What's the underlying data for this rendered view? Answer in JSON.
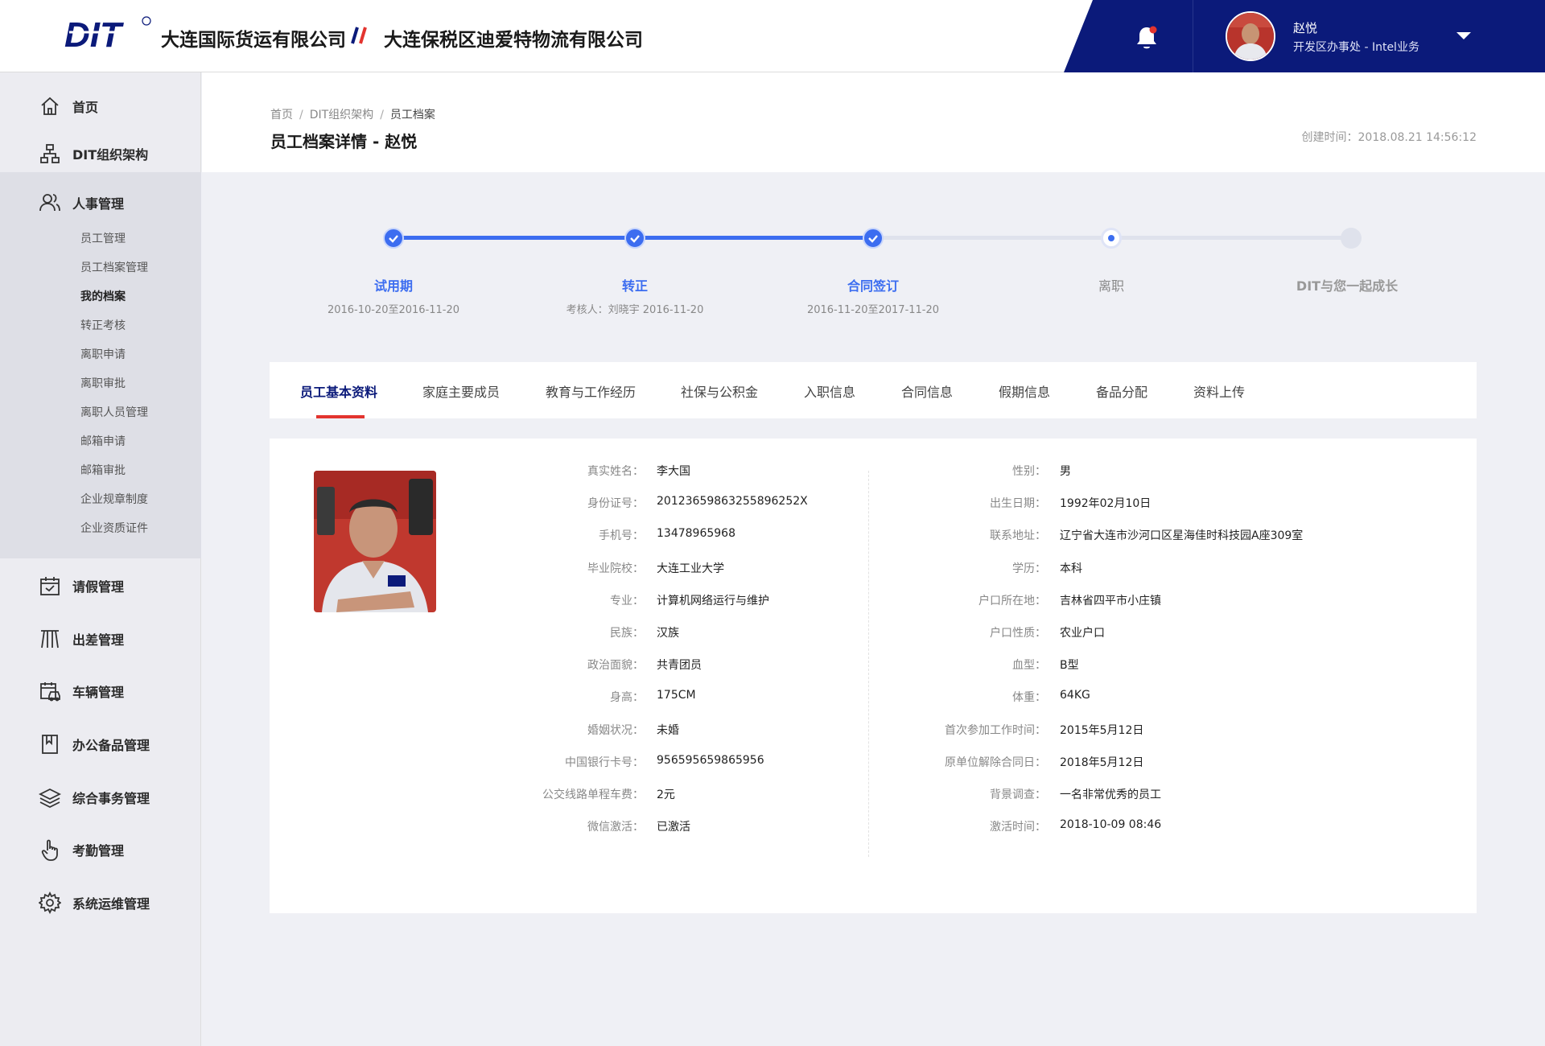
{
  "header": {
    "logo_text": "DIT",
    "company_1": "大连国际货运有限公司",
    "company_2": "大连保税区迪爱特物流有限公司",
    "user_name": "赵悦",
    "user_dept": "开发区办事处 - Intel业务",
    "bell_icon": "bell-icon",
    "notification_dot_color": "#e3342f"
  },
  "colors": {
    "brand_dark": "#0b1a7a",
    "accent_blue": "#3c6df0",
    "accent_red": "#e3342f"
  },
  "sidebar": {
    "items": [
      {
        "label": "首页",
        "icon": "home-icon"
      },
      {
        "label": "DIT组织架构",
        "icon": "org-chart-icon"
      },
      {
        "label": "人事管理",
        "icon": "users-icon"
      },
      {
        "label": "请假管理",
        "icon": "calendar-icon"
      },
      {
        "label": "出差管理",
        "icon": "luggage-icon"
      },
      {
        "label": "车辆管理",
        "icon": "vehicle-icon"
      },
      {
        "label": "办公备品管理",
        "icon": "bookmark-icon"
      },
      {
        "label": "综合事务管理",
        "icon": "layers-icon"
      },
      {
        "label": "考勤管理",
        "icon": "hand-pointer-icon"
      },
      {
        "label": "系统运维管理",
        "icon": "gear-icon"
      }
    ],
    "sub_items": [
      "员工管理",
      "员工档案管理",
      "我的档案",
      "转正考核",
      "离职申请",
      "离职审批",
      "离职人员管理",
      "邮箱申请",
      "邮箱审批",
      "企业规章制度",
      "企业资质证件"
    ],
    "active_sub": "我的档案"
  },
  "page": {
    "breadcrumb": [
      "首页",
      "DIT组织架构",
      "员工档案"
    ],
    "title": "员工档案详情 - 赵悦",
    "created": "创建时间：2018.08.21  14:56:12"
  },
  "steps": [
    {
      "title": "试用期",
      "sub": "2016-10-20至2016-11-20",
      "status": "done"
    },
    {
      "title": "转正",
      "sub": "考核人：刘晓宇 2016-11-20",
      "status": "done"
    },
    {
      "title": "合同签订",
      "sub": "2016-11-20至2017-11-20",
      "status": "done"
    },
    {
      "title": "离职",
      "sub": "",
      "status": "current"
    },
    {
      "title": "DIT与您一起成长",
      "sub": "",
      "status": "todo"
    }
  ],
  "tabs": [
    "员工基本资料",
    "家庭主要成员",
    "教育与工作经历",
    "社保与公积金",
    "入职信息",
    "合同信息",
    "假期信息",
    "备品分配",
    "资料上传"
  ],
  "profile": {
    "left": [
      {
        "label": "真实姓名：",
        "value": "李大国"
      },
      {
        "label": "身份证号：",
        "value": "20123659863255896252X"
      },
      {
        "label": "手机号：",
        "value": "13478965968"
      },
      {
        "label": "毕业院校：",
        "value": "大连工业大学"
      },
      {
        "label": "专业：",
        "value": "计算机网络运行与维护"
      },
      {
        "label": "民族：",
        "value": "汉族"
      },
      {
        "label": "政治面貌：",
        "value": "共青团员"
      },
      {
        "label": "身高：",
        "value": "175CM"
      },
      {
        "label": "婚姻状况：",
        "value": "未婚"
      },
      {
        "label": "中国银行卡号：",
        "value": "956595659865956"
      },
      {
        "label": "公交线路单程车费：",
        "value": "2元"
      },
      {
        "label": "微信激活：",
        "value": "已激活"
      }
    ],
    "right": [
      {
        "label": "性别：",
        "value": "男"
      },
      {
        "label": "出生日期：",
        "value": "1992年02月10日"
      },
      {
        "label": "联系地址：",
        "value": "辽宁省大连市沙河口区星海佳时科技园A座309室"
      },
      {
        "label": "学历：",
        "value": "本科"
      },
      {
        "label": "户口所在地：",
        "value": "吉林省四平市小庄镇"
      },
      {
        "label": "户口性质：",
        "value": "农业户口"
      },
      {
        "label": "血型：",
        "value": "B型"
      },
      {
        "label": "体重：",
        "value": "64KG"
      },
      {
        "label": "首次参加工作时间：",
        "value": "2015年5月12日"
      },
      {
        "label": "原单位解除合同日：",
        "value": "2018年5月12日"
      },
      {
        "label": "背景调查：",
        "value": "一名非常优秀的员工"
      },
      {
        "label": "激活时间：",
        "value": "2018-10-09 08:46"
      }
    ]
  }
}
